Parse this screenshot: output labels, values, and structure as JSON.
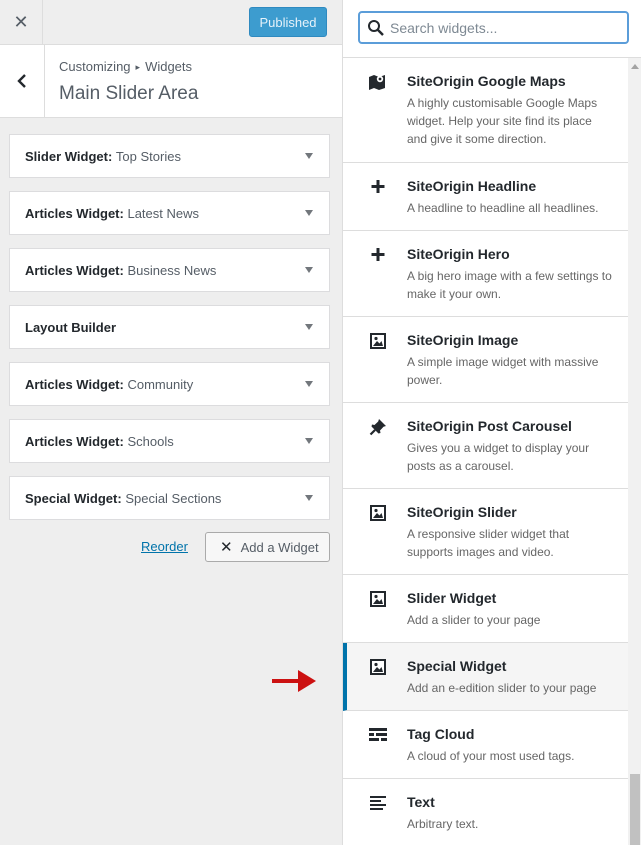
{
  "header": {
    "close_glyph": "✕",
    "publish_label": "Published",
    "publish_color": "#3d9ccf"
  },
  "section": {
    "breadcrumb_root": "Customizing",
    "breadcrumb_sep": "▸",
    "breadcrumb_leaf": "Widgets",
    "title": "Main Slider Area"
  },
  "widgets": [
    {
      "type": "Slider Widget:",
      "name": "Top Stories"
    },
    {
      "type": "Articles Widget:",
      "name": "Latest News"
    },
    {
      "type": "Articles Widget:",
      "name": "Business News"
    },
    {
      "type": "Layout Builder",
      "name": ""
    },
    {
      "type": "Articles Widget:",
      "name": "Community"
    },
    {
      "type": "Articles Widget:",
      "name": "Schools"
    },
    {
      "type": "Special Widget:",
      "name": "Special Sections"
    }
  ],
  "actions": {
    "reorder_label": "Reorder",
    "add_widget_glyph": "✕",
    "add_widget_label": "Add a Widget"
  },
  "search": {
    "placeholder": "Search widgets..."
  },
  "available": [
    {
      "name": "SiteOrigin Google Maps",
      "desc": "A highly customisable Google Maps widget. Help your site find its place and give it some direction.",
      "icon": "map-icon"
    },
    {
      "name": "SiteOrigin Headline",
      "desc": "A headline to headline all headlines.",
      "icon": "plus-icon"
    },
    {
      "name": "SiteOrigin Hero",
      "desc": "A big hero image with a few settings to make it your own.",
      "icon": "plus-icon"
    },
    {
      "name": "SiteOrigin Image",
      "desc": "A simple image widget with massive power.",
      "icon": "image-icon"
    },
    {
      "name": "SiteOrigin Post Carousel",
      "desc": "Gives you a widget to display your posts as a carousel.",
      "icon": "pin-icon"
    },
    {
      "name": "SiteOrigin Slider",
      "desc": "A responsive slider widget that supports images and video.",
      "icon": "image-icon"
    },
    {
      "name": "Slider Widget",
      "desc": "Add a slider to your page",
      "icon": "image-icon"
    },
    {
      "name": "Special Widget",
      "desc": "Add an e-edition slider to your page",
      "icon": "image-icon",
      "selected": true
    },
    {
      "name": "Tag Cloud",
      "desc": "A cloud of your most used tags.",
      "icon": "tag-cloud-icon"
    },
    {
      "name": "Text",
      "desc": "Arbitrary text.",
      "icon": "text-icon"
    }
  ],
  "colors": {
    "accent": "#0073aa",
    "annotation_arrow": "#cc1111"
  }
}
